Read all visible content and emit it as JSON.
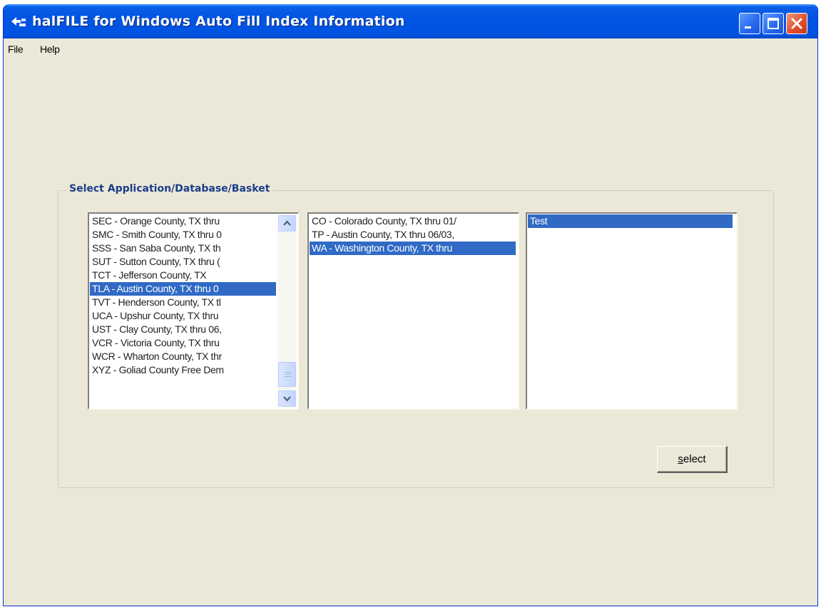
{
  "window": {
    "title": "halFILE for Windows Auto Fill Index Information"
  },
  "menu": {
    "file": "File",
    "help": "Help"
  },
  "group": {
    "label": "Select Application/Database/Basket"
  },
  "applications": {
    "items": [
      "SEC - Orange County, TX thru",
      "SMC - Smith County, TX thru 0",
      "SSS - San Saba County, TX th",
      "SUT - Sutton County, TX thru (",
      "TCT - Jefferson County, TX",
      "TLA - Austin County, TX thru 0",
      "TVT - Henderson County, TX tl",
      "UCA - Upshur County, TX thru",
      "UST - Clay County, TX thru 06,",
      "VCR - Victoria County, TX thru",
      "WCR - Wharton County, TX thr",
      "XYZ - Goliad County Free Dem"
    ],
    "selected": "TLA - Austin County, TX thru 0"
  },
  "databases": {
    "items": [
      "CO - Colorado County, TX thru 01/",
      "TP - Austin County, TX thru 06/03,",
      "WA - Washington County, TX thru"
    ],
    "selected": "WA - Washington County, TX thru"
  },
  "baskets": {
    "items": [
      "Test"
    ],
    "selected": "Test"
  },
  "buttons": {
    "select_mnemonic": "s",
    "select_rest": "elect"
  },
  "colors": {
    "titlebar": "#0054e3",
    "selection": "#316ac5",
    "window_bg": "#ebe8d8",
    "group_label": "#1b3d8a"
  }
}
